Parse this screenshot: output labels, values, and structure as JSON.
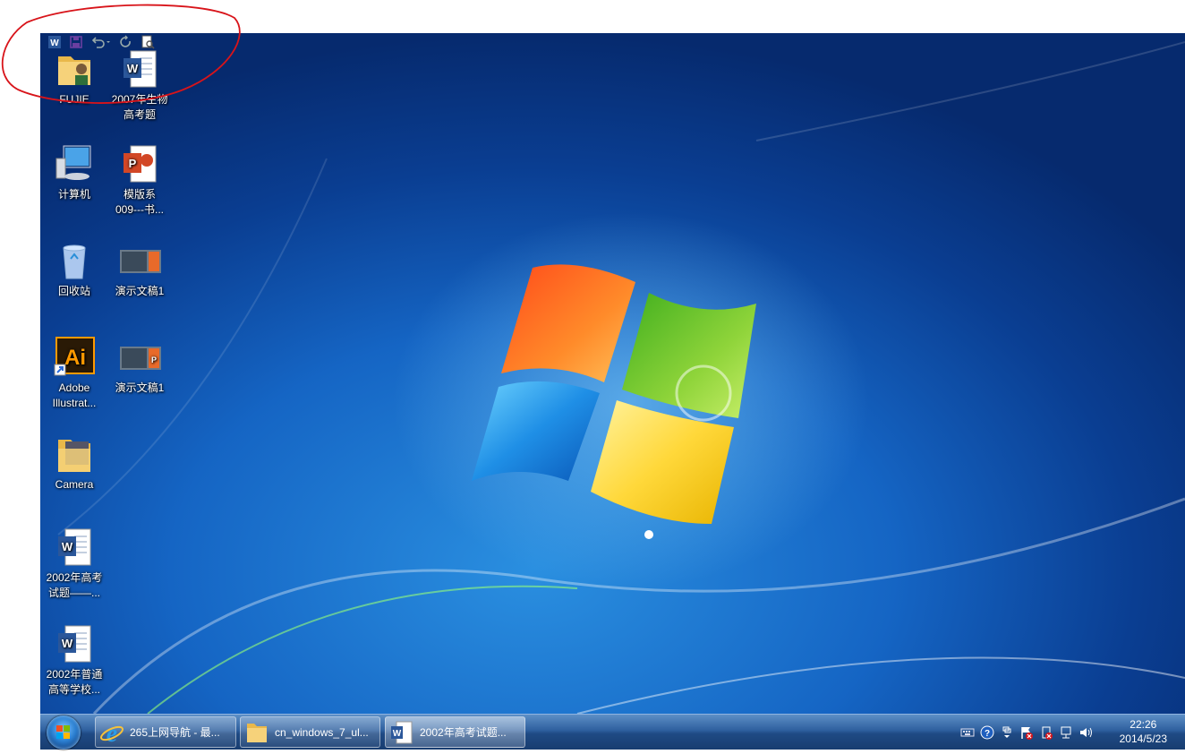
{
  "quick_access_toolbar": {
    "word_icon_letter": "W"
  },
  "desktop_icons": [
    {
      "label": "FUJIE"
    },
    {
      "label": "2007年生物\n高考题"
    },
    {
      "label": "计算机"
    },
    {
      "label": "模版系\n009---书..."
    },
    {
      "label": "回收站"
    },
    {
      "label": "演示文稿1"
    },
    {
      "label": "Adobe\nIllustrat..."
    },
    {
      "label": "演示文稿1"
    },
    {
      "label": "Camera"
    },
    {
      "label": "2002年高考\n试题——..."
    },
    {
      "label": "2002年普通\n高等学校..."
    }
  ],
  "taskbar": {
    "items": [
      {
        "label": "265上网导航 - 最..."
      },
      {
        "label": "cn_windows_7_ul..."
      },
      {
        "label": "2002年高考试题..."
      }
    ]
  },
  "clock": {
    "time": "22:26",
    "date": "2014/5/23"
  },
  "colors": {
    "annotation": "#d8141a",
    "word_blue": "#2b579a",
    "ppt_orange": "#d24726",
    "ai_orange": "#ff9a00"
  }
}
